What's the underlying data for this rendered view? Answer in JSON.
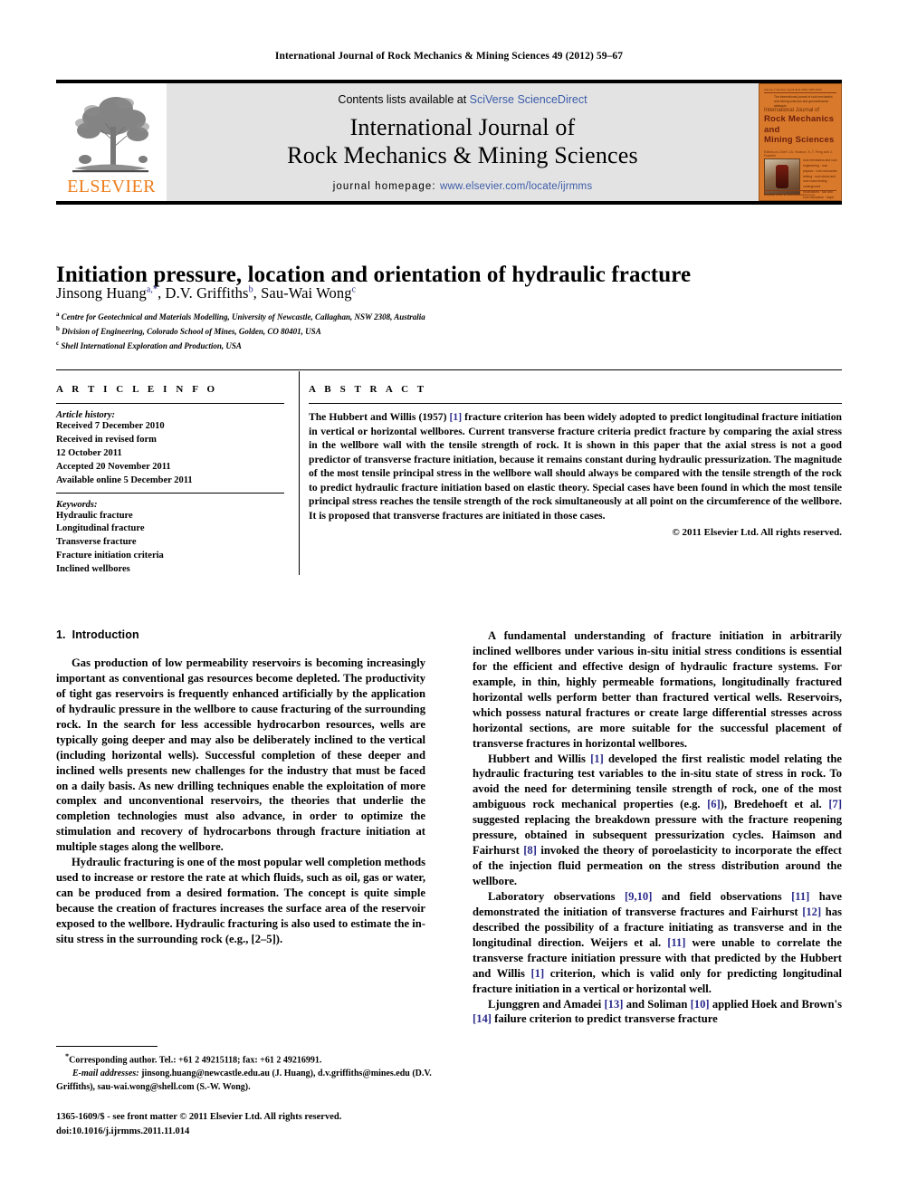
{
  "running_head": "International Journal of Rock Mechanics & Mining Sciences 49 (2012) 59–67",
  "masthead": {
    "contents_prefix": "Contents lists available at ",
    "sciencedirect": "SciVerse ScienceDirect",
    "journal_title_line1": "International Journal of",
    "journal_title_line2": "Rock Mechanics & Mining Sciences",
    "homepage_prefix": "journal homepage:",
    "homepage_url": "www.elsevier.com/locate/ijrmms",
    "publisher_wordmark": "ELSEVIER",
    "accent_link_color": "#3B5CA8",
    "elsevier_orange": "#ED7D1B",
    "cover": {
      "top_meta": "Volume 7   Number 3   April 2011   ISSN 1365-1609",
      "subtitle": "The international journal of rock mechanics and mining sciences and geomechanics abstracts",
      "kicker": "International Journal of",
      "name_line1": "Rock Mechanics",
      "name_line2": "and",
      "name_line3": "Mining  Sciences",
      "editors": "Editors-in-Chief: J.A. Hudson, X.-T. Feng and J. Franklin",
      "topics": "rock mechanics and rock engineering · rock physics · rock mechanics testing · rock stress and rock mass testing · underground excavations · soil and rock interaction · slope engineering · geothermal systems · petroleum engineering · mining and quarrying · underground storage",
      "footer": "Available online at www.sciencedirect.com",
      "background_color": "#D9792B",
      "text_color": "#6B1F10"
    }
  },
  "article": {
    "title": "Initiation pressure, location and orientation of hydraulic fracture",
    "authors": [
      {
        "name": "Jinsong Huang",
        "marks": "a,*"
      },
      {
        "name": "D.V. Griffiths",
        "marks": "b"
      },
      {
        "name": "Sau-Wai Wong",
        "marks": "c"
      }
    ],
    "affiliations": [
      {
        "mark": "a",
        "text": "Centre for Geotechnical and Materials Modelling, University of Newcastle, Callaghan, NSW 2308, Australia"
      },
      {
        "mark": "b",
        "text": "Division of Engineering, Colorado School of Mines, Golden, CO 80401, USA"
      },
      {
        "mark": "c",
        "text": "Shell International Exploration and Production, USA"
      }
    ]
  },
  "article_info": {
    "heading": "A R T I C L E   I N F O",
    "history_label": "Article history:",
    "history": [
      "Received 7 December 2010",
      "Received in revised form",
      "12 October 2011",
      "Accepted 20 November 2011",
      "Available online 5 December 2011"
    ],
    "keywords_label": "Keywords:",
    "keywords": [
      "Hydraulic fracture",
      "Longitudinal fracture",
      "Transverse fracture",
      "Fracture initiation criteria",
      "Inclined wellbores"
    ]
  },
  "abstract": {
    "heading": "A B S T R A C T",
    "part1": "The Hubbert and Willis (1957) ",
    "ref1": "[1]",
    "part2": " fracture criterion has been widely adopted to predict longitudinal fracture initiation in vertical or horizontal wellbores. Current transverse fracture criteria predict fracture by comparing the axial stress in the wellbore wall with the tensile strength of rock. It is shown in this paper that the axial stress is not a good predictor of transverse fracture initiation, because it remains constant during hydraulic pressurization. The magnitude of the most tensile principal stress in the wellbore wall should always be compared with the tensile strength of the rock to predict hydraulic fracture initiation based on elastic theory. Special cases have been found in which the most tensile principal stress reaches the tensile strength of the rock simultaneously at all point on the circumference of the wellbore. It is proposed that transverse fractures are initiated in those cases.",
    "copyright": "© 2011 Elsevier Ltd. All rights reserved."
  },
  "introduction": {
    "number": "1.",
    "title": "Introduction",
    "left_paragraphs": [
      "Gas production of low permeability reservoirs is becoming increasingly important as conventional gas resources become depleted. The productivity of tight gas reservoirs is frequently enhanced artificially by the application of hydraulic pressure in the wellbore to cause fracturing of the surrounding rock. In the search for less accessible hydrocarbon resources, wells are typically going deeper and may also be deliberately inclined to the vertical (including horizontal wells). Successful completion of these deeper and inclined wells presents new challenges for the industry that must be faced on a daily basis. As new drilling techniques enable the exploitation of more complex and unconventional reservoirs, the theories that underlie the completion technologies must also advance, in order to optimize the stimulation and recovery of hydrocarbons through fracture initiation at multiple stages along the wellbore.",
      "Hydraulic fracturing is one of the most popular well completion methods used to increase or restore the rate at which fluids, such as oil, gas or water, can be produced from a desired formation. The concept is quite simple because the creation of fractures increases the surface area of the reservoir exposed to the wellbore. Hydraulic fracturing is also used to estimate the in-situ stress in the surrounding rock (e.g., [2–5])."
    ],
    "right_paragraph_1": "A fundamental understanding of fracture initiation in arbitrarily inclined wellbores under various in-situ initial stress conditions is essential for the efficient and effective design of hydraulic fracture systems. For example, in thin, highly permeable formations, longitudinally fractured horizontal wells perform better than fractured vertical wells. Reservoirs, which possess natural fractures or create large differential stresses across horizontal sections, are more suitable for the successful placement of transverse fractures in horizontal wellbores.",
    "right_paragraph_2_a": "Hubbert and Willis ",
    "right_paragraph_2_r1": "[1]",
    "right_paragraph_2_b": " developed the first realistic model relating the hydraulic fracturing test variables to the in-situ state of stress in rock. To avoid the need for determining tensile strength of rock, one of the most ambiguous rock mechanical properties (e.g. ",
    "right_paragraph_2_r2": "[6]",
    "right_paragraph_2_c": "), Bredehoeft et al. ",
    "right_paragraph_2_r3": "[7]",
    "right_paragraph_2_d": " suggested replacing the breakdown pressure with the fracture reopening pressure, obtained in subsequent pressurization cycles. Haimson and Fairhurst ",
    "right_paragraph_2_r4": "[8]",
    "right_paragraph_2_e": " invoked the theory of poroelasticity to incorporate the effect of the injection fluid permeation on the stress distribution around the wellbore.",
    "right_paragraph_3_a": "Laboratory observations ",
    "right_paragraph_3_r1": "[9,10]",
    "right_paragraph_3_b": " and field observations ",
    "right_paragraph_3_r2": "[11]",
    "right_paragraph_3_c": " have demonstrated the initiation of transverse fractures and Fairhurst ",
    "right_paragraph_3_r3": "[12]",
    "right_paragraph_3_d": " has described the possibility of a fracture initiating as transverse and in the longitudinal direction. Weijers et al. ",
    "right_paragraph_3_r4": "[11]",
    "right_paragraph_3_e": " were unable to correlate the transverse fracture initiation pressure with that predicted by the Hubbert and Willis ",
    "right_paragraph_3_r5": "[1]",
    "right_paragraph_3_f": " criterion, which is valid only for predicting longitudinal fracture initiation in a vertical or horizontal well.",
    "right_paragraph_4_a": "Ljunggren and Amadei ",
    "right_paragraph_4_r1": "[13]",
    "right_paragraph_4_b": " and Soliman ",
    "right_paragraph_4_r2": "[10]",
    "right_paragraph_4_c": " applied Hoek and Brown's ",
    "right_paragraph_4_r3": "[14]",
    "right_paragraph_4_d": " failure criterion to predict transverse fracture"
  },
  "footnote": {
    "corresponding": "Corresponding author. Tel.: +61 2 49215118; fax: +61 2 49216991.",
    "email_label": "E-mail addresses:",
    "emails": " jinsong.huang@newcastle.edu.au (J. Huang), d.v.griffiths@mines.edu (D.V. Griffiths), sau-wai.wong@shell.com (S.-W. Wong).",
    "imprint_line1": "1365-1609/$ - see front matter © 2011 Elsevier Ltd. All rights reserved.",
    "imprint_line2": "doi:10.1016/j.ijrmms.2011.11.014"
  }
}
